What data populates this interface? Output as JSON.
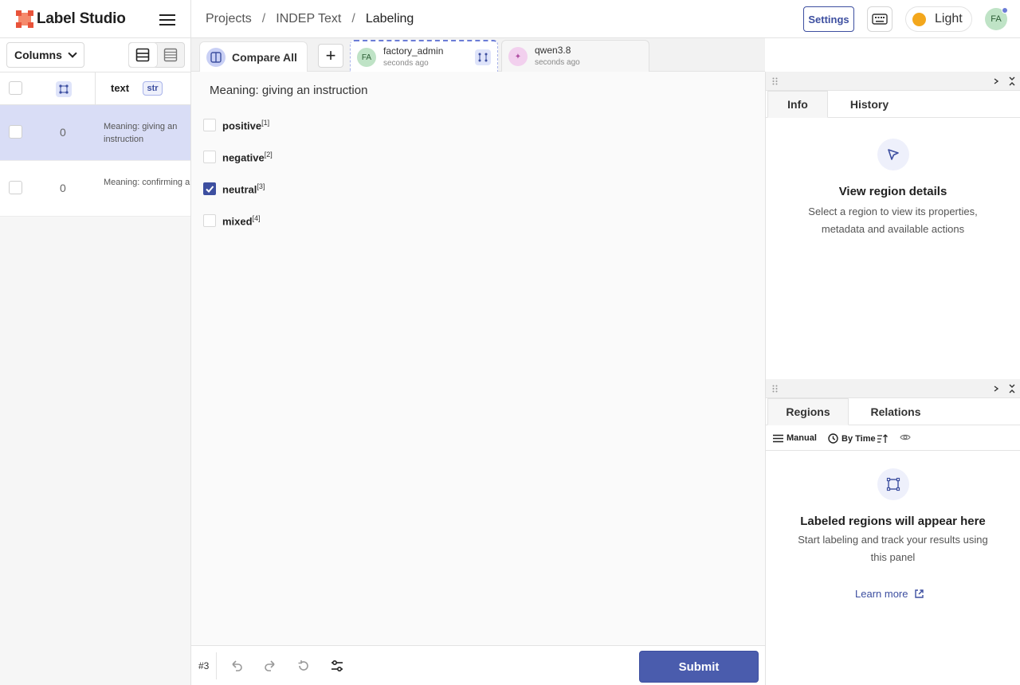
{
  "app": {
    "brand": "Label Studio",
    "breadcrumbs": [
      "Projects",
      "INDEP Text",
      "Labeling"
    ],
    "settings_label": "Settings",
    "theme_label": "Light",
    "user_initials": "FA",
    "colors": {
      "accent": "#3d4fa0",
      "submit": "#4a5cad",
      "selected_row": "#d9ddf6",
      "theme_dot": "#f3a71c",
      "logo": "#f58a6c"
    }
  },
  "task_list": {
    "columns_label": "Columns",
    "header": {
      "text_col": "text",
      "type_badge": "str"
    },
    "rows": [
      {
        "annotations": "0",
        "text": "Meaning: giving an instruction",
        "selected": true
      },
      {
        "annotations": "0",
        "text": "Meaning: confirming appointment",
        "selected": false
      }
    ]
  },
  "annotation_tabs": {
    "compare_label": "Compare All",
    "add_label": "+",
    "tabs": [
      {
        "initials": "FA",
        "name": "factory_admin",
        "time": "seconds ago",
        "active": true
      },
      {
        "initials": "✦",
        "name": "qwen3.8",
        "time": "seconds ago",
        "active": false
      }
    ]
  },
  "task": {
    "text": "Meaning: giving an instruction",
    "choices": [
      {
        "label": "positive",
        "hotkey": "[1]",
        "checked": false
      },
      {
        "label": "negative",
        "hotkey": "[2]",
        "checked": false
      },
      {
        "label": "neutral",
        "hotkey": "[3]",
        "checked": true
      },
      {
        "label": "mixed",
        "hotkey": "[4]",
        "checked": false
      }
    ]
  },
  "bottom": {
    "task_id": "#3",
    "submit_label": "Submit"
  },
  "info_panel": {
    "tabs": [
      "Info",
      "History"
    ],
    "empty_title": "View region details",
    "empty_desc": "Select a region to view its properties, metadata and available actions"
  },
  "regions_panel": {
    "tabs": [
      "Regions",
      "Relations"
    ],
    "toolbar": {
      "group_label": "Manual",
      "sort_label": "By Time"
    },
    "empty_title": "Labeled regions will appear here",
    "empty_desc": "Start labeling and track your results using this panel",
    "learn_more": "Learn more"
  }
}
